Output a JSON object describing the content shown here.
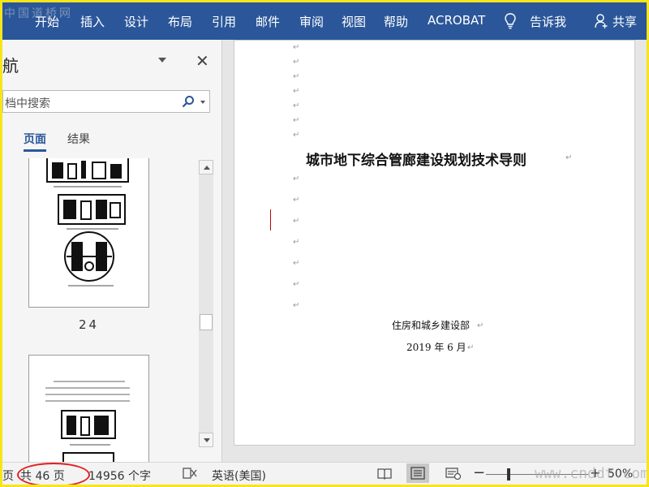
{
  "watermark_top": "中国道桥网",
  "watermark_bottom": "www.cnddt.com",
  "ribbon_tabs": [
    "开始",
    "插入",
    "设计",
    "布局",
    "引用",
    "邮件",
    "审阅",
    "视图",
    "帮助",
    "ACROBAT"
  ],
  "tell_me": "告诉我",
  "share": "共享",
  "nav": {
    "title": "航",
    "search_placeholder": "档中搜索",
    "tabs": [
      "页面",
      "结果"
    ],
    "page_number": "24"
  },
  "document": {
    "title": "城市地下综合管廊建设规划技术导则",
    "publisher": "住房和城乡建设部",
    "date": "2019 年 6 月"
  },
  "status": {
    "page": "页",
    "total_pages": "共 46 页",
    "words": "14956 个字",
    "language": "英语(美国)",
    "zoom": "50%"
  },
  "colors": {
    "ribbon": "#2b579a",
    "highlight_oval": "#e02020",
    "frame": "#f7e51a"
  }
}
